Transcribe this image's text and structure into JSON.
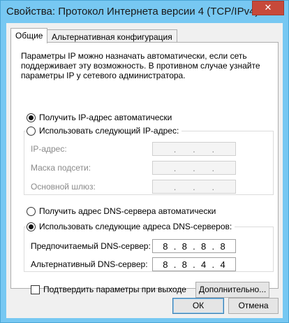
{
  "window": {
    "title": "Свойства: Протокол Интернета версии 4 (TCP/IPv4)",
    "close_glyph": "✕"
  },
  "tabs": [
    {
      "label": "Общие",
      "active": true
    },
    {
      "label": "Альтернативная конфигурация",
      "active": false
    }
  ],
  "general": {
    "description": "Параметры IP можно назначать автоматически, если сеть поддерживает эту возможность. В противном случае узнайте параметры IP у сетевого администратора.",
    "ip_auto_label": "Получить IP-адрес автоматически",
    "ip_auto_checked": true,
    "ip_manual_label": "Использовать следующий IP-адрес:",
    "ip_manual_checked": false,
    "ip_address_label": "IP-адрес:",
    "subnet_mask_label": "Маска подсети:",
    "gateway_label": "Основной шлюз:",
    "dns_auto_label": "Получить адрес DNS-сервера автоматически",
    "dns_auto_checked": false,
    "dns_manual_label": "Использовать следующие адреса DNS-серверов:",
    "dns_manual_checked": true,
    "preferred_dns_label": "Предпочитаемый DNS-сервер:",
    "preferred_dns": [
      "8",
      "8",
      "8",
      "8"
    ],
    "alternate_dns_label": "Альтернативный DNS-сервер:",
    "alternate_dns": [
      "8",
      "8",
      "4",
      "4"
    ],
    "validate_label": "Подтвердить параметры при выходе",
    "validate_checked": false,
    "advanced_button": "Дополнительно..."
  },
  "footer": {
    "ok_button": "ОК",
    "cancel_button": "Отмена"
  },
  "colors": {
    "frame": "#77c8f2",
    "close_button": "#c7493a",
    "disabled_text": "#8a8a8a"
  }
}
